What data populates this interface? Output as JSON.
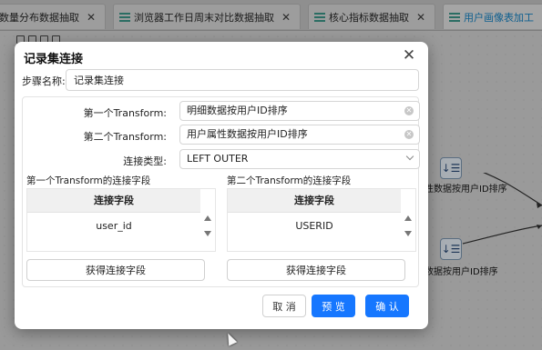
{
  "tabs": [
    {
      "label": "数量分布数据抽取",
      "active": false
    },
    {
      "label": "浏览器工作日周末对比数据抽取",
      "active": false
    },
    {
      "label": "核心指标数据抽取",
      "active": false
    },
    {
      "label": "用户画像表加工",
      "active": true
    }
  ],
  "canvas": {
    "nodes": [
      {
        "icon": "sort-list-icon",
        "label": "性数据按用户ID排序"
      },
      {
        "icon": "sort-list-icon",
        "label": "数据按用户ID排序"
      }
    ]
  },
  "dialog": {
    "title": "记录集连接",
    "step_name_label": "步骤名称:",
    "step_name_value": "记录集连接",
    "first_transform_label": "第一个Transform:",
    "first_transform_value": "明细数据按用户ID排序",
    "second_transform_label": "第二个Transform:",
    "second_transform_value": "用户属性数据按用户ID排序",
    "join_type_label": "连接类型:",
    "join_type_value": "LEFT OUTER",
    "first_fields": {
      "title": "第一个Transform的连接字段",
      "header": "连接字段",
      "rows": [
        "user_id"
      ],
      "get_button": "获得连接字段"
    },
    "second_fields": {
      "title": "第二个Transform的连接字段",
      "header": "连接字段",
      "rows": [
        "USERID"
      ],
      "get_button": "获得连接字段"
    },
    "cancel_label": "取 消",
    "preview_label": "预 览",
    "confirm_label": "确 认"
  },
  "colors": {
    "primary": "#1677ff",
    "overlay_tab_text": "#0e5f8f"
  }
}
